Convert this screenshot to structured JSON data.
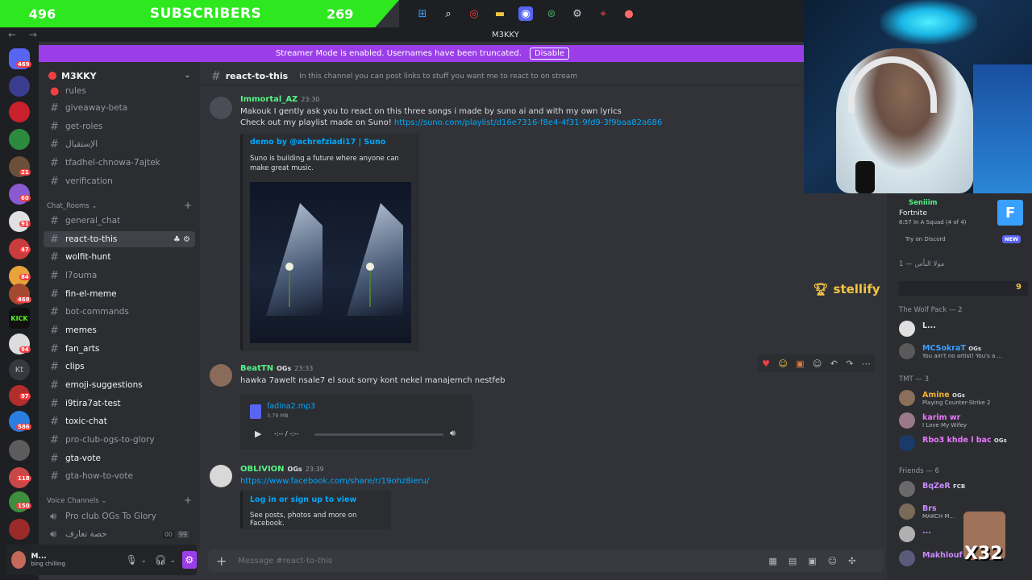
{
  "overlay": {
    "sub_left": "496",
    "sub_label": "SUBSCRIBERS",
    "sub_right": "269"
  },
  "window": {
    "title": "M3KKY",
    "nav_arrows": "← →"
  },
  "streamer_banner": {
    "text": "Streamer Mode is enabled. Usernames have been truncated.",
    "button": "Disable"
  },
  "server": {
    "name": "M3KKY"
  },
  "channels": [
    {
      "name": "rules",
      "type": "text"
    },
    {
      "name": "giveaway-beta",
      "type": "text"
    },
    {
      "name": "get-roles",
      "type": "text"
    },
    {
      "name": "الإستقبال",
      "type": "text"
    },
    {
      "name": "tfadhel-chnowa-7ajtek",
      "type": "text"
    },
    {
      "name": "verification",
      "type": "text"
    }
  ],
  "category_chat": "Chat_Rooms",
  "chat_channels": [
    {
      "name": "general_chat",
      "selected": false
    },
    {
      "name": "react-to-this",
      "selected": true
    },
    {
      "name": "wolfit-hunt",
      "selected": false
    },
    {
      "name": "l7ouma",
      "selected": false
    },
    {
      "name": "fin-el-meme",
      "selected": false
    },
    {
      "name": "bot-commands",
      "selected": false
    },
    {
      "name": "memes",
      "selected": false
    },
    {
      "name": "fan_arts",
      "selected": false
    },
    {
      "name": "clips",
      "selected": false
    },
    {
      "name": "emoji-suggestions",
      "selected": false
    },
    {
      "name": "i9tira7at-test",
      "selected": false
    },
    {
      "name": "toxic-chat",
      "selected": false
    },
    {
      "name": "pro-club-ogs-to-glory",
      "selected": false
    },
    {
      "name": "gta-vote",
      "selected": false
    },
    {
      "name": "gta-how-to-vote",
      "selected": false
    }
  ],
  "category_voice": "Voice Channels",
  "voice_channels": [
    {
      "name": "Pro club OGs To Glory"
    },
    {
      "name": "حصة تعارف",
      "count_a": "00",
      "count_b": "99"
    }
  ],
  "user_panel": {
    "name": "M...",
    "status": "bing chilling"
  },
  "channel_header": {
    "name": "react-to-this",
    "topic": "In this channel you can post links to stuff you want me to react to on stream"
  },
  "messages": [
    {
      "author": "Immortal_AZ",
      "time": "23:30",
      "line1": "Makouk I gently ask you to react on this three songs i made by suno ai and with my own lyrics",
      "line2_prefix": "Check out my playlist made on Suno! ",
      "line2_link": "https://suno.com/playlist/d16e7316-f8e4-4f31-9fd9-3f9baa82a686",
      "embed_title": "demo by @achrefziadi17 | Suno",
      "embed_desc": "Suno is building a future where anyone can make great music."
    },
    {
      "author": "BeatTN",
      "badge": "OGs",
      "time": "23:33",
      "text": "hawka 7awelt nsale7 el sout sorry kont nekel manajemch nestfeb",
      "file_name": "fadina2.mp3",
      "file_size": "3.79 MB",
      "player_time": "-:-- / -:--"
    },
    {
      "author": "OBLIVION",
      "badge": "OGs",
      "time": "23:39",
      "link": "https://www.facebook.com/share/r/19ohz8ieru/",
      "embed_title": "Log in or sign up to view",
      "embed_desc": "See posts, photos and more on Facebook."
    }
  ],
  "composer": {
    "placeholder": "Message #react-to-this"
  },
  "activity": {
    "user": "Seniiim",
    "game": "Fortnite",
    "detail": "6:57 In A Squad (4 of 4)",
    "cta": "Try on Discord",
    "new_badge": "NEW"
  },
  "overlay_stellify": {
    "label": "stellify",
    "count": "9"
  },
  "member_groups": [
    {
      "heading": "1 — مولا البأس"
    },
    {
      "heading": "The Wolf Pack — 2",
      "members": [
        {
          "name": "L...",
          "status": "",
          "color": "#dbdee1"
        },
        {
          "name": "MCSokraT",
          "badge": "OGs",
          "status": "You ain't no artist! You's a ...",
          "color": "#3ba3ff"
        }
      ]
    },
    {
      "heading": "TMT — 3",
      "members": [
        {
          "name": "Amine",
          "badge": "OGs",
          "status": "Playing Counter-Strike 2",
          "color": "#f0b232"
        },
        {
          "name": "karim wr",
          "status": "I Love My Wifey",
          "color": "#e978ff"
        },
        {
          "name": "Rbo3 khde l bac",
          "badge": "OGs",
          "status": "",
          "color": "#e978ff"
        }
      ]
    },
    {
      "heading": "Friends — 6",
      "members": [
        {
          "name": "BqZeR",
          "badge": "FCB",
          "status": "",
          "color": "#c98bff"
        },
        {
          "name": "Brs",
          "status": "MAKCH M...",
          "color": "#c98bff"
        },
        {
          "name": "...",
          "status": "",
          "color": "#c98bff"
        },
        {
          "name": "Makhlouf",
          "status": "",
          "color": "#c98bff"
        }
      ]
    }
  ],
  "rail_badges": [
    "469",
    "21",
    "60",
    "91",
    "47",
    "84",
    "468",
    "94",
    "97",
    "586",
    "118",
    "150"
  ],
  "x32": "X32",
  "colors": {
    "subscriber_green": "#2ee81f",
    "streamer_purple": "#9b3eea",
    "link": "#00a8fc",
    "og_green": "#3ba55d"
  }
}
